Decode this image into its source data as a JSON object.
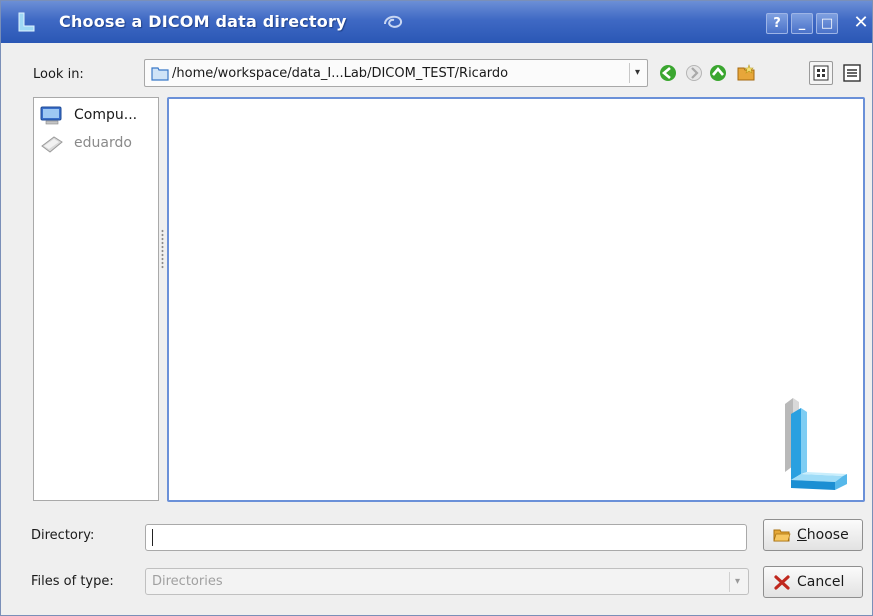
{
  "window": {
    "title": "Choose a DICOM data directory",
    "controls": {
      "help": "?",
      "minimize": "_",
      "maximize": "□",
      "close": "✕"
    }
  },
  "lookin": {
    "label": "Look in:",
    "path": "/home/workspace/data_I...Lab/DICOM_TEST/Ricardo",
    "dropdown_arrow": "▾"
  },
  "toolbar_icons": [
    "back-icon",
    "forward-icon",
    "up-icon",
    "new-folder-icon",
    "detail-view-icon",
    "list-view-icon"
  ],
  "sidebar": {
    "items": [
      {
        "label": "Compu...",
        "icon": "computer-icon"
      },
      {
        "label": "eduardo",
        "icon": "user-folder-icon"
      }
    ]
  },
  "bottom": {
    "directory_label": "Directory:",
    "directory_value": "",
    "files_of_type_label": "Files of type:",
    "files_of_type_value": "Directories",
    "choose_button_prefix": "C",
    "choose_button_rest": "hoose",
    "cancel_button": "Cancel"
  },
  "colors": {
    "titlebar": "#3f69c4",
    "selection_border": "#6a90d8",
    "watermark": "#4fb6e8"
  }
}
